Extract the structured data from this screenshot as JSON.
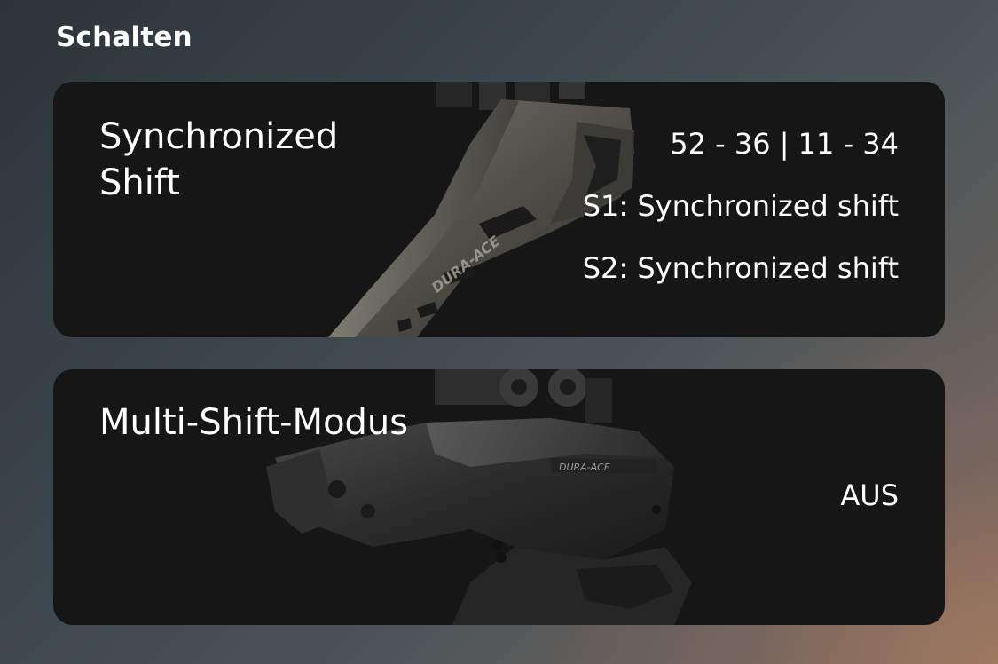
{
  "section": {
    "title": "Schalten"
  },
  "cards": {
    "synchronized_shift": {
      "title": "Synchronized Shift",
      "gear_ratio": "52 - 36 | 11 - 34",
      "s1": "S1: Synchronized shift",
      "s2": "S2: Synchronized shift",
      "image": "front-derailleur-image",
      "logo_text": "DURA-ACE"
    },
    "multi_shift": {
      "title": "Multi-Shift-Modus",
      "value": "AUS",
      "image": "rear-derailleur-image",
      "logo_text": "DURA-ACE"
    }
  },
  "colors": {
    "card_background": "#161616",
    "text": "#ffffff",
    "derailleur_metal": "#5a5752",
    "derailleur_dark": "#2a2a2a"
  }
}
